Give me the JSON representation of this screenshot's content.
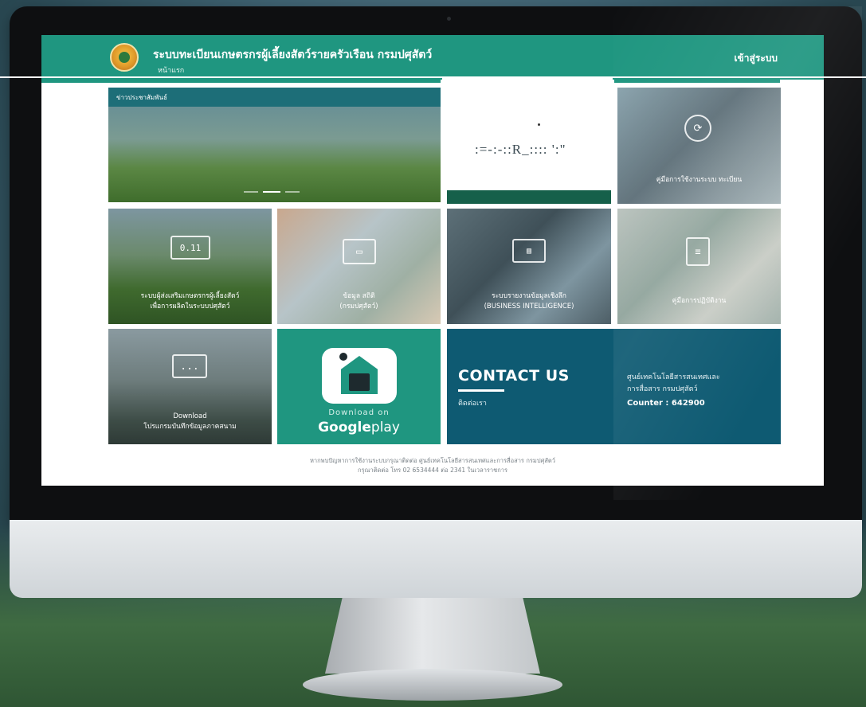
{
  "header": {
    "title": "ระบบทะเบียนเกษตรกรผู้เลี้ยงสัตว์รายครัวเรือน กรมปศุสัตว์",
    "subtitle": "หน้าแรก",
    "login_label": "เข้าสู่ระบบ"
  },
  "news": {
    "label": "ข่าวประชาสัมพันธ์"
  },
  "mid_garbled_text": ":=-:-::R_:::: ':\"",
  "tiles": {
    "manual": {
      "label": "คู่มือการใช้งานระบบ ทะเบียน"
    },
    "system1": {
      "icon_text": "0.11",
      "label_line1": "ระบบผู้ส่งเสริมเกษตรกรผู้เลี้ยงสัตว์",
      "label_line2": "เพื่อการผลิตในระบบปศุสัตว์"
    },
    "report": {
      "label_line1": "ข้อมูล สถิติ",
      "label_line2": "(กรมปศุสัตว์)"
    },
    "bi": {
      "label_line1": "ระบบรายงานข้อมูลเชิงลึก",
      "label_line2": "(BUSINESS INTELLIGENCE)"
    },
    "survey": {
      "label": "คู่มือการปฏิบัติงาน"
    },
    "download_form": {
      "icon_text": "...",
      "label_line1": "Download",
      "label_line2": "โปรแกรมบันทึกข้อมูลภาคสนาม"
    }
  },
  "google_play": {
    "small": "Download on",
    "big_bold": "Google",
    "big_light": "play"
  },
  "contact": {
    "title": "CONTACT US",
    "link": "ติดต่อเรา",
    "org_line1": "ศูนย์เทคโนโลยีสารสนเทศและ",
    "org_line2": "การสื่อสาร กรมปศุสัตว์",
    "counter": "Counter : 642900"
  },
  "footer": {
    "line1": "หากพบปัญหาการใช้งานระบบกรุณาติดต่อ ศูนย์เทคโนโลยีสารสนเทศและการสื่อสาร กรมปศุสัตว์",
    "line2": "กรุณาติดต่อ โทร 02 6534444 ต่อ 2341 ในเวลาราชการ"
  },
  "colors": {
    "brand_green": "#1f9680",
    "contact_blue": "#0e5a72",
    "news_bar": "#1d6e78"
  }
}
